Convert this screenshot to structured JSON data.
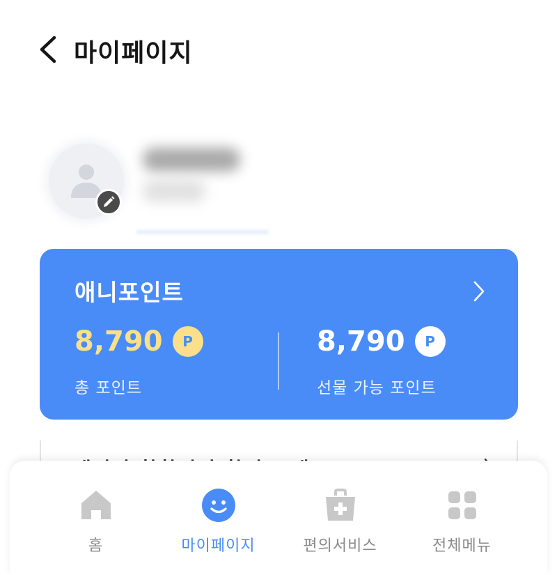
{
  "header": {
    "title": "마이페이지",
    "back_icon": "chevron-left-icon"
  },
  "profile": {
    "avatar_icon": "person-icon",
    "edit_icon": "pencil-icon"
  },
  "points_card": {
    "title": "애니포인트",
    "total_points": "8,790",
    "total_label": "총 포인트",
    "gift_points": "8,790",
    "gift_label": "선물 가능 포인트",
    "point_badge": "P",
    "accent_color": "#4a8cf7",
    "total_color": "#fbe089"
  },
  "promo": {
    "text": "애니핏 합합걷기 할인 소개"
  },
  "tabbar": {
    "tabs": [
      {
        "label": "홈",
        "icon": "home-icon",
        "active": false
      },
      {
        "label": "마이페이지",
        "icon": "smiley-icon",
        "active": true
      },
      {
        "label": "편의서비스",
        "icon": "medical-bag-icon",
        "active": false
      },
      {
        "label": "전체메뉴",
        "icon": "grid-icon",
        "active": false
      }
    ]
  }
}
